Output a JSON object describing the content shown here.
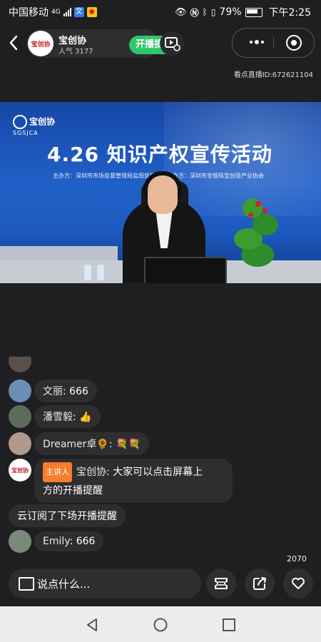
{
  "status_bar": {
    "carrier": "中国移动",
    "network": "4G",
    "battery": "79%",
    "time": "下午2:25"
  },
  "header": {
    "avatar_text": "宝创协",
    "host_name": "宝创协",
    "popularity": "人气 3177",
    "remind_button": "开播提醒"
  },
  "room_id": "看点直播ID:672621104",
  "video": {
    "logo_text": "宝创协",
    "logo_sub": "SGSJCA",
    "title": "4.26 知识产权宣传活动",
    "subtitle": "主办方：深圳市市场监督管理局盐田监管局　协办方：深圳市金银珠宝创意产业协会"
  },
  "chat": {
    "messages": [
      {
        "name": "文丽",
        "text": "666"
      },
      {
        "name": "潘雪毅",
        "text": "👍"
      },
      {
        "name": "Dreamer卓🌻",
        "text": "💐💐"
      },
      {
        "name": "宝创协",
        "tag": "主讲人",
        "line1": "大家可以点击屏幕上",
        "line2": "方的开播提醒"
      },
      {
        "notice": "云订阅了下场开播提醒"
      },
      {
        "name": "Emily",
        "text": "666"
      }
    ]
  },
  "like_count": "2070",
  "input": {
    "placeholder": "说点什么..."
  },
  "icons": {
    "coupon": "coupon-icon",
    "share": "share-icon",
    "like": "heart-icon"
  }
}
